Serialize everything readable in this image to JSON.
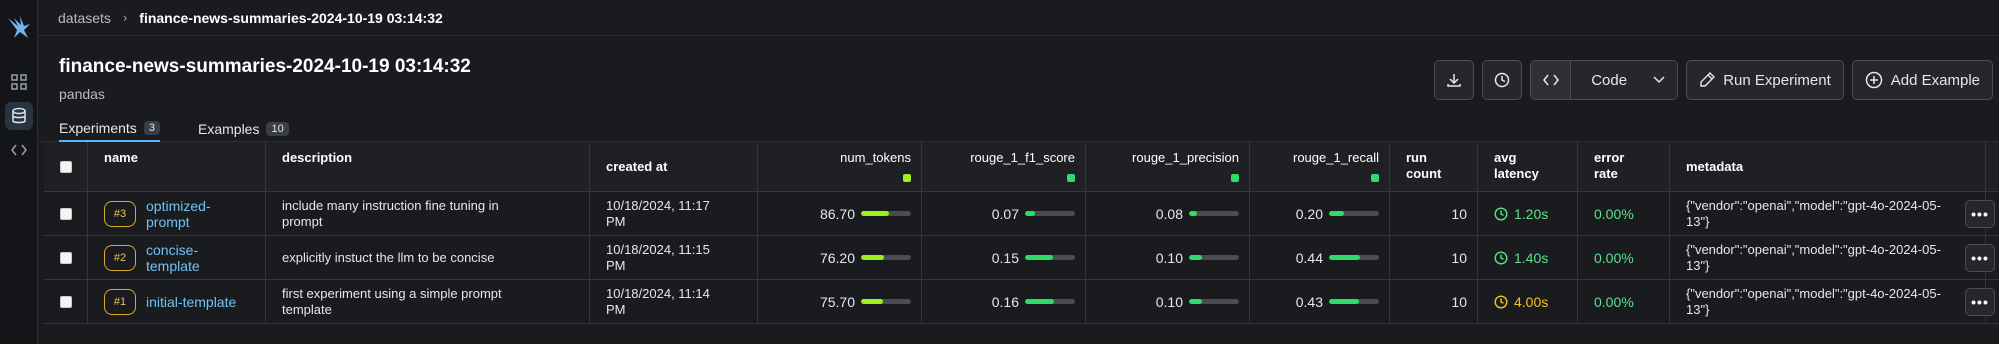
{
  "breadcrumb": {
    "root": "datasets",
    "current": "finance-news-summaries-2024-10-19 03:14:32"
  },
  "header": {
    "title": "finance-news-summaries-2024-10-19 03:14:32",
    "subtitle": "pandas"
  },
  "actions": {
    "code_label": "Code",
    "run_label": "Run Experiment",
    "add_label": "Add Example"
  },
  "tabs": [
    {
      "label": "Experiments",
      "count": "3"
    },
    {
      "label": "Examples",
      "count": "10"
    }
  ],
  "columns": {
    "name": "name",
    "description": "description",
    "created_at": "created at",
    "num_tokens": "num_tokens",
    "f1": "rouge_1_f1_score",
    "precision": "rouge_1_precision",
    "recall": "rouge_1_recall",
    "run_count_1": "run",
    "run_count_2": "count",
    "latency_1": "avg",
    "latency_2": "latency",
    "error_1": "error",
    "error_2": "rate",
    "metadata": "metadata"
  },
  "rows": [
    {
      "seq": "#3",
      "name_1": "optimized-",
      "name_2": "prompt",
      "desc_1": "include many instruction fine tuning in",
      "desc_2": "prompt",
      "created_1": "10/18/2024, 11:17",
      "created_2": "PM",
      "num_tokens": "86.70",
      "num_tokens_fill": 0.55,
      "f1": "0.07",
      "f1_fill": 0.2,
      "precision": "0.08",
      "precision_fill": 0.15,
      "recall": "0.20",
      "recall_fill": 0.3,
      "run_count": "10",
      "latency": "1.20s",
      "latency_color": "#5de08d",
      "error_rate": "0.00%",
      "meta_1": "{\"vendor\":\"openai\",\"model\":\"gpt-4o-2024-05-",
      "meta_2": "13\"}"
    },
    {
      "seq": "#2",
      "name_1": "concise-",
      "name_2": "template",
      "desc_1": "explicitly instuct the llm to be concise",
      "desc_2": "",
      "created_1": "10/18/2024, 11:15",
      "created_2": "PM",
      "num_tokens": "76.20",
      "num_tokens_fill": 0.45,
      "f1": "0.15",
      "f1_fill": 0.55,
      "precision": "0.10",
      "precision_fill": 0.25,
      "recall": "0.44",
      "recall_fill": 0.62,
      "run_count": "10",
      "latency": "1.40s",
      "latency_color": "#5de08d",
      "error_rate": "0.00%",
      "meta_1": "{\"vendor\":\"openai\",\"model\":\"gpt-4o-2024-05-",
      "meta_2": "13\"}"
    },
    {
      "seq": "#1",
      "name_1": "initial-template",
      "name_2": "",
      "desc_1": "first experiment using a simple prompt",
      "desc_2": "template",
      "created_1": "10/18/2024, 11:14",
      "created_2": "PM",
      "num_tokens": "75.70",
      "num_tokens_fill": 0.44,
      "f1": "0.16",
      "f1_fill": 0.58,
      "precision": "0.10",
      "precision_fill": 0.25,
      "recall": "0.43",
      "recall_fill": 0.6,
      "run_count": "10",
      "latency": "4.00s",
      "latency_color": "#f0c419",
      "error_rate": "0.00%",
      "meta_1": "{\"vendor\":\"openai\",\"model\":\"gpt-4o-2024-05-",
      "meta_2": "13\"}"
    }
  ]
}
